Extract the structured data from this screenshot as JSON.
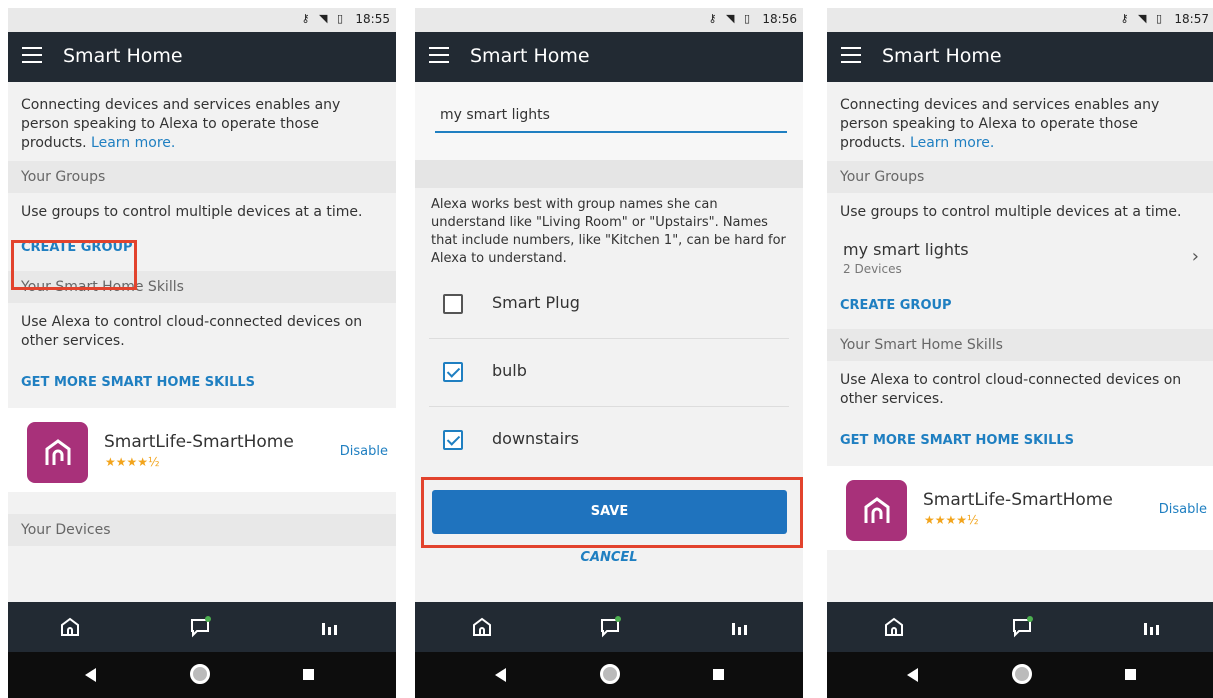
{
  "phones": [
    {
      "status_time": "18:55",
      "app_title": "Smart Home",
      "intro_text": "Connecting devices and services enables any person speaking to Alexa to operate those products.",
      "learn_more": "Learn more.",
      "groups_header": "Your Groups",
      "groups_text": "Use groups to control multiple devices at a time.",
      "create_group": "CREATE GROUP",
      "skills_header": "Your Smart Home Skills",
      "skills_text": "Use Alexa to control cloud-connected devices on other services.",
      "get_more_skills": "GET MORE SMART HOME SKILLS",
      "skill_name": "SmartLife-SmartHome",
      "skill_rating": "★★★★½",
      "skill_action": "Disable",
      "devices_header": "Your Devices"
    },
    {
      "status_time": "18:56",
      "app_title": "Smart Home",
      "group_name_value": "my smart lights",
      "hint_text": "Alexa works best with group names she can understand like \"Living Room\" or \"Upstairs\". Names that include numbers, like \"Kitchen 1\", can be hard for Alexa to understand.",
      "devices": [
        {
          "label": "Smart Plug",
          "checked": false
        },
        {
          "label": "bulb",
          "checked": true
        },
        {
          "label": "downstairs",
          "checked": true
        }
      ],
      "save_label": "SAVE",
      "cancel_label": "CANCEL"
    },
    {
      "status_time": "18:57",
      "app_title": "Smart Home",
      "intro_text": "Connecting devices and services enables any person speaking to Alexa to operate those products.",
      "learn_more": "Learn more.",
      "groups_header": "Your Groups",
      "groups_text": "Use groups to control multiple devices at a time.",
      "group_name": "my smart lights",
      "group_sub": "2 Devices",
      "create_group": "CREATE GROUP",
      "skills_header": "Your Smart Home Skills",
      "skills_text": "Use Alexa to control cloud-connected devices on other services.",
      "get_more_skills": "GET MORE SMART HOME SKILLS",
      "skill_name": "SmartLife-SmartHome",
      "skill_rating": "★★★★½",
      "skill_action": "Disable"
    }
  ],
  "colors": {
    "appbar": "#222a33",
    "accent": "#1f7fc1",
    "highlight": "#e2432d",
    "skill_logo": "#a8317a"
  },
  "icons": [
    "menu-icon",
    "home-icon",
    "chat-icon",
    "bars-icon",
    "back-icon",
    "circle-home-icon",
    "recents-icon",
    "chevron-right-icon",
    "smartlife-logo-icon",
    "key-icon",
    "wifi-icon",
    "battery-icon"
  ]
}
